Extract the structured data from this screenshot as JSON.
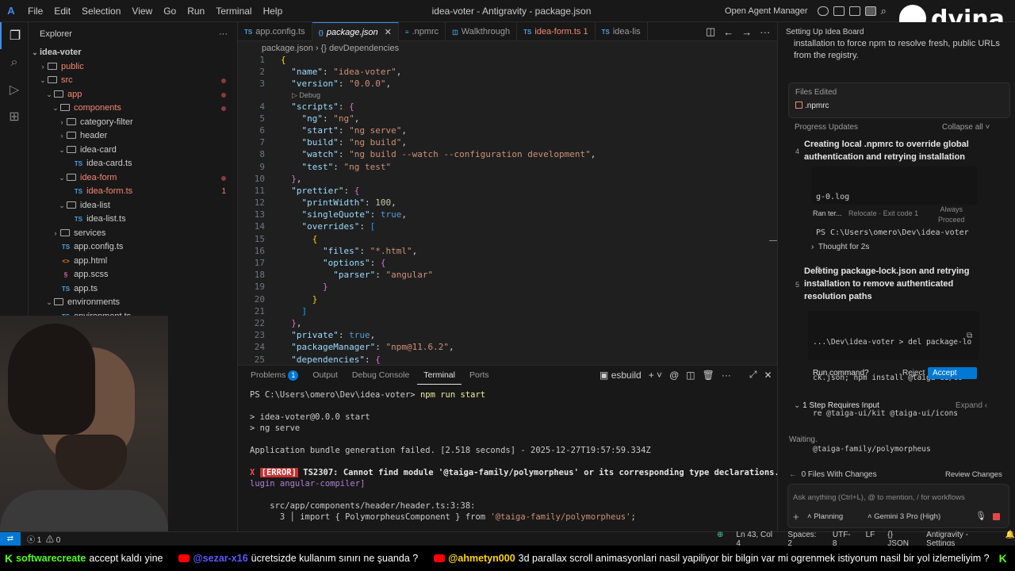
{
  "titlebar": {
    "logo": "A",
    "menu": [
      "File",
      "Edit",
      "Selection",
      "View",
      "Go",
      "Run",
      "Terminal",
      "Help"
    ],
    "window_title": "idea-voter - Antigravity - package.json",
    "open_agent_manager": "Open Agent Manager"
  },
  "explorer": {
    "title": "Explorer",
    "more": "···",
    "tree": [
      {
        "label": "idea-voter",
        "depth": 0,
        "type": "root",
        "open": true
      },
      {
        "label": "public",
        "depth": 1,
        "type": "folder",
        "open": false,
        "err": true
      },
      {
        "label": "src",
        "depth": 1,
        "type": "folder",
        "open": true,
        "err": true,
        "dot": true
      },
      {
        "label": "app",
        "depth": 2,
        "type": "folder",
        "open": true,
        "err": true,
        "dot": true
      },
      {
        "label": "components",
        "depth": 3,
        "type": "folder",
        "open": true,
        "err": true,
        "dot": true
      },
      {
        "label": "category-filter",
        "depth": 4,
        "type": "folder",
        "open": false
      },
      {
        "label": "header",
        "depth": 4,
        "type": "folder",
        "open": false
      },
      {
        "label": "idea-card",
        "depth": 4,
        "type": "folder",
        "open": true
      },
      {
        "label": "idea-card.ts",
        "depth": 5,
        "type": "ts"
      },
      {
        "label": "idea-form",
        "depth": 4,
        "type": "folder",
        "open": true,
        "err": true,
        "dot": true
      },
      {
        "label": "idea-form.ts",
        "depth": 5,
        "type": "ts",
        "err": true,
        "count": "1"
      },
      {
        "label": "idea-list",
        "depth": 4,
        "type": "folder",
        "open": true
      },
      {
        "label": "idea-list.ts",
        "depth": 5,
        "type": "ts"
      },
      {
        "label": "services",
        "depth": 3,
        "type": "folder",
        "open": false
      },
      {
        "label": "app.config.ts",
        "depth": 3,
        "type": "ts"
      },
      {
        "label": "app.html",
        "depth": 3,
        "type": "html"
      },
      {
        "label": "app.scss",
        "depth": 3,
        "type": "scss"
      },
      {
        "label": "app.ts",
        "depth": 3,
        "type": "ts"
      },
      {
        "label": "environments",
        "depth": 2,
        "type": "folder",
        "open": true
      },
      {
        "label": "environment.ts",
        "depth": 3,
        "type": "ts"
      }
    ]
  },
  "tabs": [
    {
      "label": "app.config.ts",
      "icon": "TS"
    },
    {
      "label": "package.json",
      "icon": "{}",
      "active": true
    },
    {
      "label": ".npmrc",
      "icon": "≡"
    },
    {
      "label": "Walkthrough",
      "icon": "◫"
    },
    {
      "label": "idea-form.ts 1",
      "icon": "TS",
      "err": true
    },
    {
      "label": "idea-lis",
      "icon": "TS"
    }
  ],
  "breadcrumb": {
    "file": "package.json",
    "sep": "›",
    "node": "{} devDependencies"
  },
  "codelens": "▷ Debug",
  "code_lines": [
    {
      "n": "1",
      "html": "<span class='b'>{</span>"
    },
    {
      "n": "2",
      "html": "  <span class='k'>\"name\"</span><span class='p'>: </span><span class='s'>\"idea-voter\"</span><span class='p'>,</span>"
    },
    {
      "n": "3",
      "html": "  <span class='k'>\"version\"</span><span class='p'>: </span><span class='s'>\"0.0.0\"</span><span class='p'>,</span>"
    },
    {
      "n": "",
      "lens": true
    },
    {
      "n": "4",
      "html": "  <span class='k'>\"scripts\"</span><span class='p'>: </span><span class='b2'>{</span>"
    },
    {
      "n": "5",
      "html": "    <span class='k'>\"ng\"</span><span class='p'>: </span><span class='s'>\"ng\"</span><span class='p'>,</span>"
    },
    {
      "n": "6",
      "html": "    <span class='k'>\"start\"</span><span class='p'>: </span><span class='s'>\"ng serve\"</span><span class='p'>,</span>"
    },
    {
      "n": "7",
      "html": "    <span class='k'>\"build\"</span><span class='p'>: </span><span class='s'>\"ng build\"</span><span class='p'>,</span>"
    },
    {
      "n": "8",
      "html": "    <span class='k'>\"watch\"</span><span class='p'>: </span><span class='s'>\"ng build --watch --configuration development\"</span><span class='p'>,</span>"
    },
    {
      "n": "9",
      "html": "    <span class='k'>\"test\"</span><span class='p'>: </span><span class='s'>\"ng test\"</span>"
    },
    {
      "n": "10",
      "html": "  <span class='b2'>}</span><span class='p'>,</span>"
    },
    {
      "n": "11",
      "html": "  <span class='k'>\"prettier\"</span><span class='p'>: </span><span class='b2'>{</span>"
    },
    {
      "n": "12",
      "html": "    <span class='k'>\"printWidth\"</span><span class='p'>: </span><span class='n'>100</span><span class='p'>,</span>"
    },
    {
      "n": "13",
      "html": "    <span class='k'>\"singleQuote\"</span><span class='p'>: </span><span class='kw'>true</span><span class='p'>,</span>"
    },
    {
      "n": "14",
      "html": "    <span class='k'>\"overrides\"</span><span class='p'>: </span><span class='b3'>[</span>"
    },
    {
      "n": "15",
      "html": "      <span class='b'>{</span>"
    },
    {
      "n": "16",
      "html": "        <span class='k'>\"files\"</span><span class='p'>: </span><span class='s'>\"*.html\"</span><span class='p'>,</span>"
    },
    {
      "n": "17",
      "html": "        <span class='k'>\"options\"</span><span class='p'>: </span><span class='b2'>{</span>"
    },
    {
      "n": "18",
      "html": "          <span class='k'>\"parser\"</span><span class='p'>: </span><span class='s'>\"angular\"</span>"
    },
    {
      "n": "19",
      "html": "        <span class='b2'>}</span>"
    },
    {
      "n": "20",
      "html": "      <span class='b'>}</span>"
    },
    {
      "n": "21",
      "html": "    <span class='b3'>]</span>"
    },
    {
      "n": "22",
      "html": "  <span class='b2'>}</span><span class='p'>,</span>"
    },
    {
      "n": "23",
      "html": "  <span class='k'>\"private\"</span><span class='p'>: </span><span class='kw'>true</span><span class='p'>,</span>"
    },
    {
      "n": "24",
      "html": "  <span class='k'>\"packageManager\"</span><span class='p'>: </span><span class='s'>\"npm@11.6.2\"</span><span class='p'>,</span>"
    },
    {
      "n": "25",
      "html": "  <span class='k'>\"dependencies\"</span><span class='p'>: </span><span class='b2'>{</span>"
    }
  ],
  "panel": {
    "tabs": [
      "Problems",
      "Output",
      "Debug Console",
      "Terminal",
      "Ports"
    ],
    "problems_badge": "1",
    "active_tab": "Terminal",
    "terminal_name": "esbuild",
    "terminal_lines": [
      {
        "html": "PS C:\\Users\\omero\\Dev\\idea-voter&gt; <span class='cmd'>npm run start</span>"
      },
      {
        "html": ""
      },
      {
        "html": "&gt; idea-voter@0.0.0 start"
      },
      {
        "html": "&gt; ng serve"
      },
      {
        "html": ""
      },
      {
        "html": "Application bundle generation failed. [2.518 seconds] - 2025-12-27T19:57:59.334Z"
      },
      {
        "html": ""
      },
      {
        "html": "<span class='x'>X</span> <span class='errtag'>[ERROR]</span> <span class='bold'>TS2307: Cannot find module '@taiga-family/polymorpheus' or its corresponding type declarations.</span> <span class='plug'>[p</span>"
      },
      {
        "html": "<span class='plug'>lugin angular-compiler]</span>"
      },
      {
        "html": ""
      },
      {
        "html": "    src/app/components/header/header.ts:3:38:"
      },
      {
        "html": "      3 │ import { PolymorpheusComponent } from <span class='str'>'@taiga-family/polymorpheus'</span>;"
      }
    ]
  },
  "agent": {
    "header": "Setting Up Idea Board",
    "intro": "installation to force npm to resolve fresh, public URLs from the registry.",
    "files_edited_label": "Files Edited",
    "files_edited": [
      ".npmrc"
    ],
    "progress_label": "Progress Updates",
    "collapse_all": "Collapse all",
    "step4_num": "4",
    "step4_title": "Creating local .npmrc to override global authentication and retrying installation",
    "step4_term": [
      "g-0.log",
      "PS C:\\Users\\omero\\Dev\\idea-voter",
      ">"
    ],
    "step4_ran": "Ran ter...",
    "step4_relocate": "Relocate",
    "step4_exit": "· Exit code 1",
    "step4_always": "Always",
    "step4_proceed": "Proceed",
    "thought": "Thought for 2s",
    "step5_num": "5",
    "step5_title": "Deleting package-lock.json and retrying installation to remove authenticated resolution paths",
    "step5_cmd": [
      "...\\Dev\\idea-voter > del package-lo",
      "ck.json; npm install @taiga-ui/co",
      "re @taiga-ui/kit @taiga-ui/icons",
      "@taiga-family/polymorpheus"
    ],
    "run_command": "Run command?",
    "reject": "Reject",
    "accept": "Accept",
    "requires_input": "1 Step Requires Input",
    "expand": "Expand",
    "waiting": "Waiting.",
    "files_with_changes": "0 Files With Changes",
    "review_changes": "Review Changes",
    "input_placeholder": "Ask anything (Ctrl+L), @ to mention, / for workflows",
    "mode": "Planning",
    "model": "Gemini 3 Pro (High)"
  },
  "status": {
    "errors": "1",
    "warnings": "0",
    "position": "Ln 43, Col 4",
    "spaces": "Spaces: 2",
    "encoding": "UTF-8",
    "eol": "LF",
    "language": "{} JSON",
    "product": "Antigravity - Settings"
  },
  "ticker": [
    {
      "platform": "kick",
      "user": "softwarecreate",
      "msg": "accept kaldı yine"
    },
    {
      "platform": "youtube",
      "user": "@sezar-x16",
      "msg": "ücretsizde kullanım sınırı ne şuanda ?"
    },
    {
      "platform": "youtube",
      "user": "@ahmetyn000",
      "msg": "3d parallax scroll animasyonlari nasil yapiliyor bir bilgin var mi ogrenmek istiyorum nasil bir yol izlemeliyim ?"
    }
  ],
  "brand": "dvina",
  "colors": {
    "accent": "#0078d4",
    "error": "#f48771",
    "kick": "#53fc18",
    "youtube": "#ff0000"
  }
}
